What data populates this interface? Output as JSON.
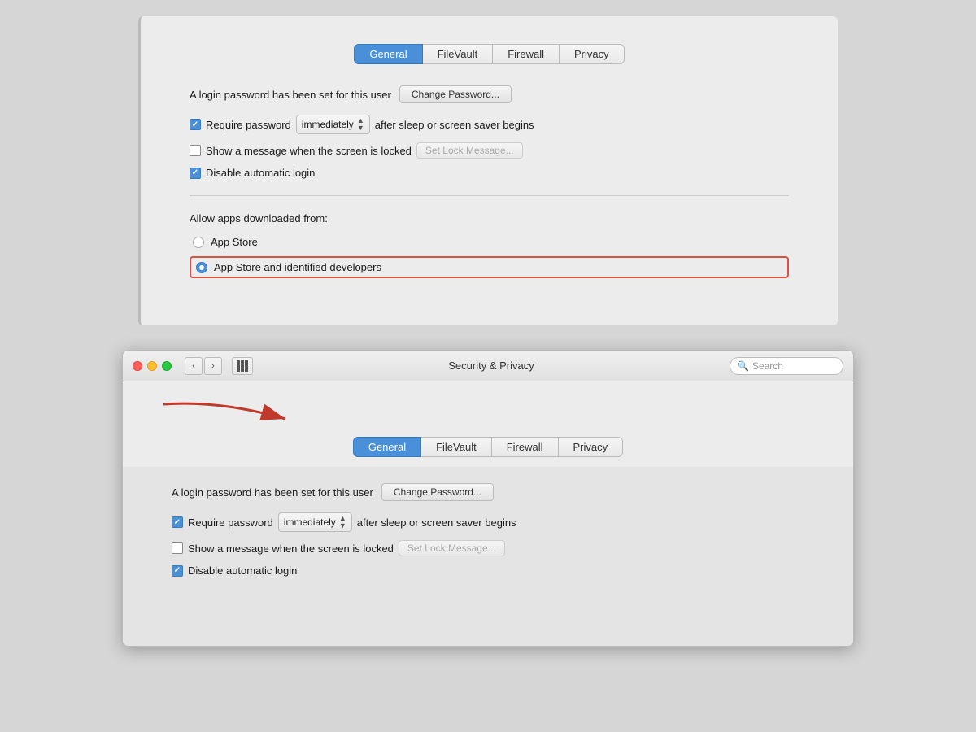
{
  "topPanel": {
    "tabs": [
      "General",
      "FileVault",
      "Firewall",
      "Privacy"
    ],
    "activeTab": "General",
    "loginPasswordText": "A login password has been set for this user",
    "changePasswordLabel": "Change Password...",
    "requirePasswordLabel": "Require password",
    "immediatelyValue": "immediately",
    "afterSleepLabel": "after sleep or screen saver begins",
    "showMessageLabel": "Show a message when the screen is locked",
    "setLockMessageLabel": "Set Lock Message...",
    "disableAutoLoginLabel": "Disable automatic login",
    "allowAppsLabel": "Allow apps downloaded from:",
    "appStoreLabel": "App Store",
    "appStoreIdentifiedLabel": "App Store and identified developers"
  },
  "bottomWindow": {
    "title": "Security & Privacy",
    "searchPlaceholder": "Search",
    "tabs": [
      "General",
      "FileVault",
      "Firewall",
      "Privacy"
    ],
    "activeTab": "General",
    "loginPasswordText": "A login password has been set for this user",
    "changePasswordLabel": "Change Password...",
    "requirePasswordLabel": "Require password",
    "immediatelyValue": "immediately",
    "afterSleepLabel": "after sleep or screen saver begins",
    "showMessageLabel": "Show a message when the screen is locked",
    "setLockMessageLabel": "Set Lock Message...",
    "disableAutoLoginLabel": "Disable automatic login"
  },
  "icons": {
    "search": "🔍",
    "back": "‹",
    "forward": "›",
    "grid": "⊞"
  }
}
